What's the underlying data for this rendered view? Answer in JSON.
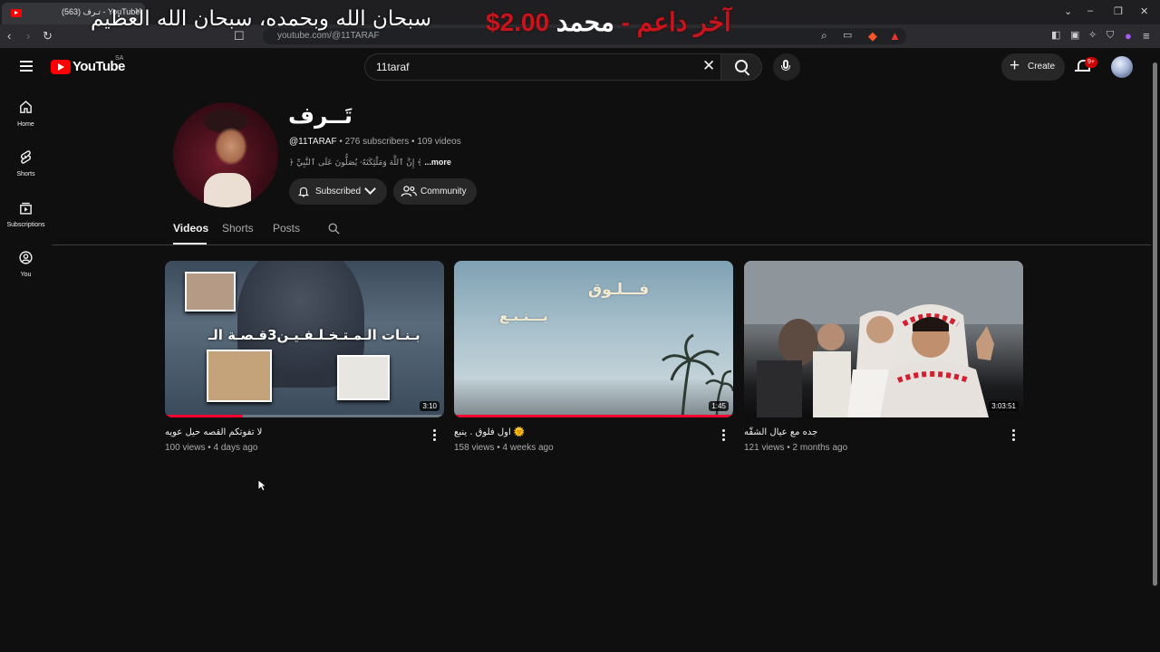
{
  "browser": {
    "tab_title": "(563) تـرف - YouTube",
    "url": "youtube.com/@11TARAF",
    "overlay_text": "سبحان الله وبحمده، سبحان الله العظيم",
    "donation_amount": "$2.00",
    "donation_label": "آخر داعم -",
    "donation_name": "محمد"
  },
  "header": {
    "logo_text": "YouTube",
    "country_code": "SA",
    "search_value": "11taraf",
    "create_label": "Create",
    "notification_count": "9+"
  },
  "sidebar": {
    "items": [
      {
        "label": "Home",
        "icon": "home-icon"
      },
      {
        "label": "Shorts",
        "icon": "shorts-icon"
      },
      {
        "label": "Subscriptions",
        "icon": "subscriptions-icon"
      },
      {
        "label": "You",
        "icon": "you-icon"
      }
    ]
  },
  "channel": {
    "name": "تَــرف",
    "handle": "@11TARAF",
    "subscribers": "276 subscribers",
    "videos_count": "109 videos",
    "separator": "•",
    "description": "﴿ إِنَّ ٱللَّهَ وَمَلَٰٓئِكَتَهُۥ يُصَلُّونَ عَلَى ٱلنَّبِيِّ ﴾",
    "more_label": "...more",
    "subscribe_label": "Subscribed",
    "community_label": "Community"
  },
  "tabs": [
    {
      "label": "Videos",
      "active": true
    },
    {
      "label": "Shorts",
      "active": false
    },
    {
      "label": "Posts",
      "active": false
    }
  ],
  "videos": [
    {
      "title": "لا تفوتكم القصه حيل عويه",
      "views": "100 views",
      "age": "4 days ago",
      "duration": "3:10",
      "watched_fraction": 0.28,
      "thumb_text_a": "قـصـة الـ",
      "thumb_text_num": "3",
      "thumb_text_b": "بـنـات الـمـتـخـلـفـيـن"
    },
    {
      "title": "اول فلوق . ينبع 🌞",
      "views": "158 views",
      "age": "4 weeks ago",
      "duration": "1:45",
      "watched_fraction": 1.0,
      "thumb_text_a": "فـــلـوق",
      "thumb_text_b": "يـــنـبـع"
    },
    {
      "title": "جده مع عيال الشقّه",
      "views": "121 views",
      "age": "2 months ago",
      "duration": "3:03:51",
      "watched_fraction": 0
    }
  ],
  "colors": {
    "background": "#0f0f0f",
    "brand_red": "#ff0000",
    "progress_red": "#ff0033",
    "chip_bg": "#272727"
  }
}
